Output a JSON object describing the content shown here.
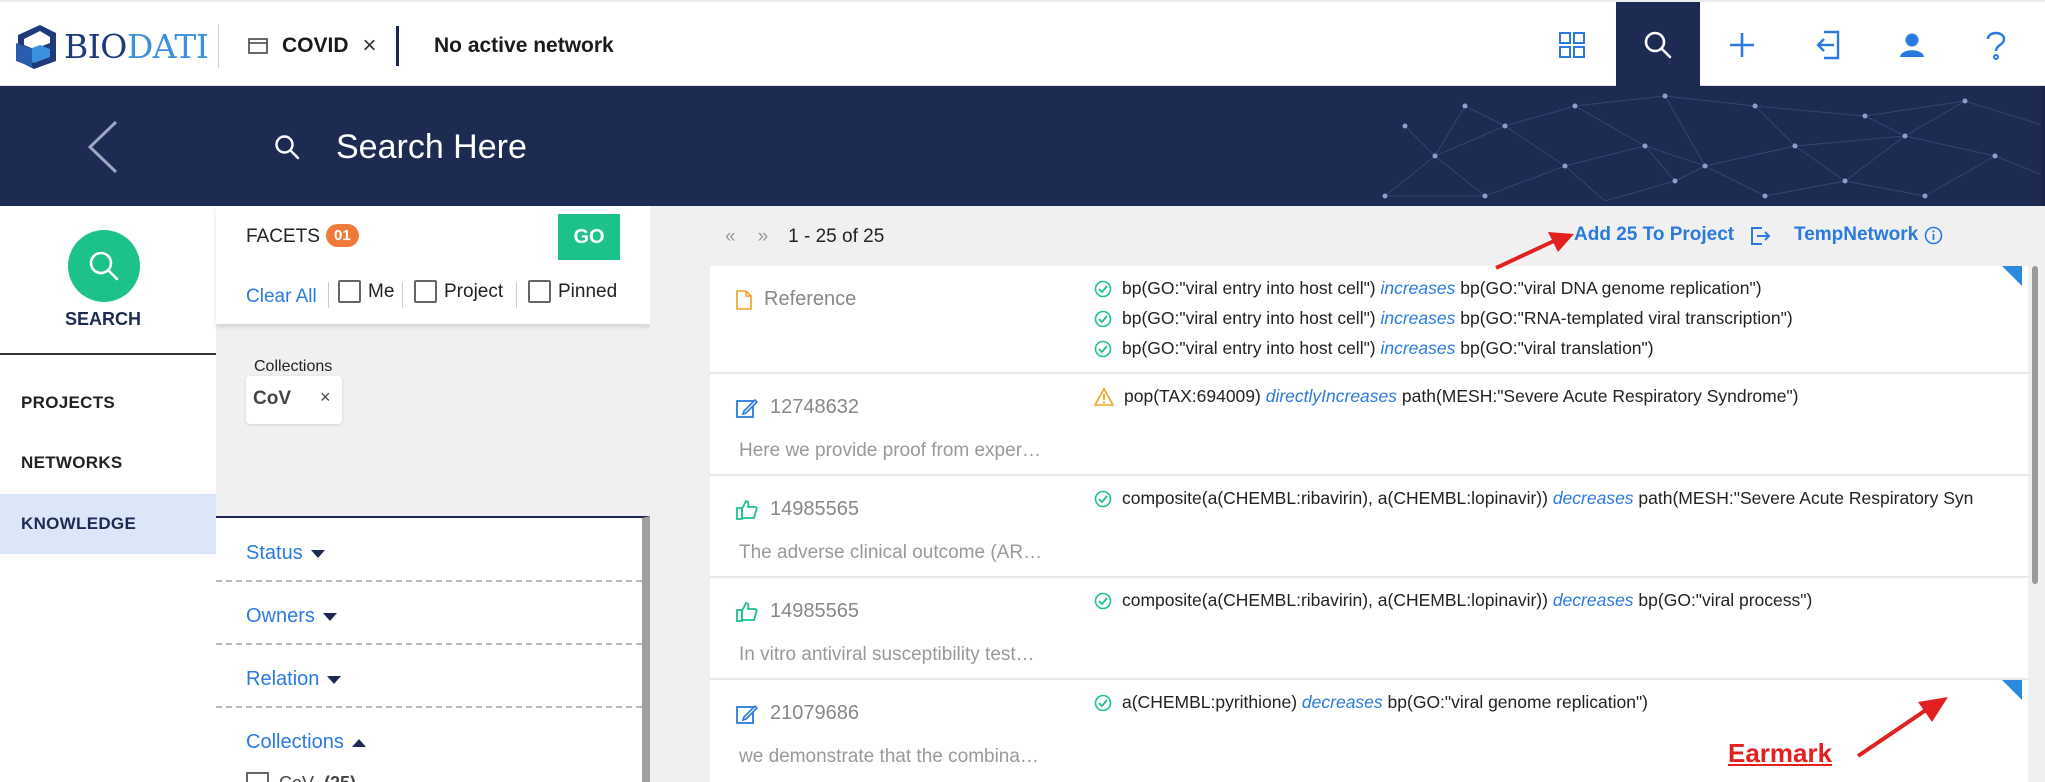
{
  "app": {
    "logo_bio": "BIO",
    "logo_dati": "DATI",
    "tab_label": "COVID",
    "tab_close": "×",
    "network_status": "No active network"
  },
  "topbar_icons": [
    "apps-grid-icon",
    "search-icon",
    "plus-icon",
    "import-icon",
    "user-icon",
    "help-icon"
  ],
  "hero": {
    "search_placeholder": "Search Here"
  },
  "leftnav": {
    "search_label": "SEARCH",
    "items": [
      {
        "label": "PROJECTS"
      },
      {
        "label": "NETWORKS"
      },
      {
        "label": "KNOWLEDGE"
      }
    ]
  },
  "facets": {
    "title": "FACETS",
    "badge": "01",
    "go": "GO",
    "clear_all": "Clear All",
    "checkboxes": [
      "Me",
      "Project",
      "Pinned"
    ],
    "collections_label": "Collections",
    "chip": {
      "label": "CoV",
      "close": "×"
    },
    "filters": [
      {
        "label": "Status"
      },
      {
        "label": "Owners"
      },
      {
        "label": "Relation"
      },
      {
        "label": "Collections"
      }
    ],
    "cov_item": "CoV",
    "cov_count": "(25)"
  },
  "results": {
    "prev": "«",
    "next": "»",
    "range": "1 - 25 of 25",
    "add_to_project": "Add 25 To Project",
    "temp_network": "TempNetwork",
    "cards": [
      {
        "id": "Reference",
        "icon": "document-icon",
        "snippet": "",
        "statements": [
          {
            "subject": "bp(GO:\"viral entry into host cell\")",
            "relation": "increases",
            "object": "bp(GO:\"viral DNA genome replication\")",
            "status": "ok"
          },
          {
            "subject": "bp(GO:\"viral entry into host cell\")",
            "relation": "increases",
            "object": "bp(GO:\"RNA-templated viral transcription\")",
            "status": "ok"
          },
          {
            "subject": "bp(GO:\"viral entry into host cell\")",
            "relation": "increases",
            "object": "bp(GO:\"viral translation\")",
            "status": "ok"
          }
        ]
      },
      {
        "id": "12748632",
        "icon": "edit-icon",
        "snippet": "Here we provide proof from exper…",
        "statements": [
          {
            "subject": "pop(TAX:694009)",
            "relation": "directlyIncreases",
            "object": "path(MESH:\"Severe Acute Respiratory Syndrome\")",
            "status": "warn"
          }
        ]
      },
      {
        "id": "14985565",
        "icon": "thumbs-up-icon",
        "snippet": "The adverse clinical outcome (AR…",
        "statements": [
          {
            "subject": "composite(a(CHEMBL:ribavirin), a(CHEMBL:lopinavir))",
            "relation": "decreases",
            "object": "path(MESH:\"Severe Acute Respiratory Syn",
            "status": "ok"
          }
        ]
      },
      {
        "id": "14985565",
        "icon": "thumbs-up-icon",
        "snippet": "In vitro antiviral susceptibility test…",
        "statements": [
          {
            "subject": "composite(a(CHEMBL:ribavirin), a(CHEMBL:lopinavir))",
            "relation": "decreases",
            "object": "bp(GO:\"viral process\")",
            "status": "ok"
          }
        ]
      },
      {
        "id": "21079686",
        "icon": "edit-icon",
        "snippet": "we demonstrate that the combina…",
        "statements": [
          {
            "subject": "a(CHEMBL:pyrithione)",
            "relation": "decreases",
            "object": "bp(GO:\"viral genome replication\")",
            "status": "ok"
          }
        ]
      }
    ]
  },
  "annotation": {
    "earmark": "Earmark"
  },
  "colors": {
    "navy": "#1d2b53",
    "green": "#1dc28a",
    "link_blue": "#2a7ae0",
    "badge_orange": "#f07a3c",
    "annotation_red": "#e22020"
  }
}
